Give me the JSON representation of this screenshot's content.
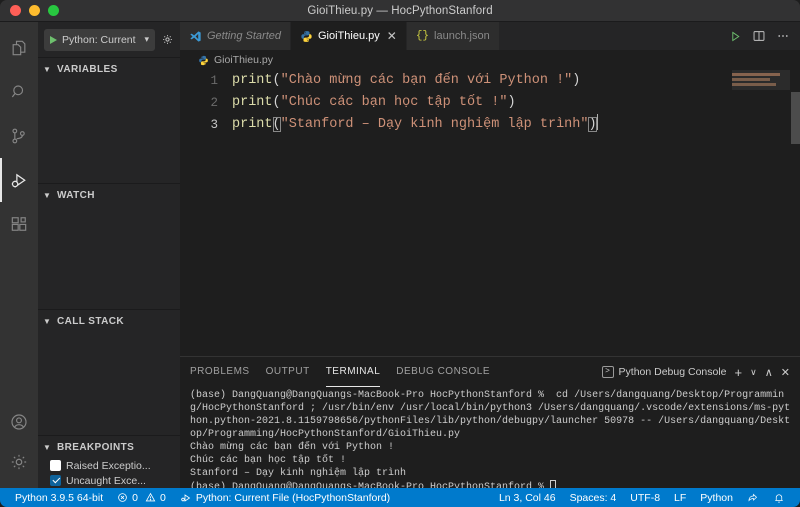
{
  "window": {
    "title": "GioiThieu.py — HocPythonStanford",
    "traffic_lights": [
      "close",
      "minimize",
      "zoom"
    ]
  },
  "activity_bar": {
    "top_items": [
      {
        "name": "explorer",
        "icon": "files-icon",
        "active": false
      },
      {
        "name": "search",
        "icon": "search-icon",
        "active": false
      },
      {
        "name": "source-control",
        "icon": "source-control-icon",
        "active": false
      },
      {
        "name": "run-and-debug",
        "icon": "run-debug-icon",
        "active": true
      },
      {
        "name": "extensions",
        "icon": "extensions-icon",
        "active": false
      }
    ],
    "bottom_items": [
      {
        "name": "accounts",
        "icon": "account-icon"
      },
      {
        "name": "settings",
        "icon": "gear-icon"
      }
    ]
  },
  "sidebar": {
    "launch_config": {
      "label": "Python: Current",
      "start_icon": "play-icon",
      "dropdown_icon": "chevron-down-icon",
      "settings_icon": "gear-icon"
    },
    "panes": [
      {
        "name": "variables",
        "title": "VARIABLES",
        "collapsed": false
      },
      {
        "name": "watch",
        "title": "WATCH",
        "collapsed": false
      },
      {
        "name": "call-stack",
        "title": "CALL STACK",
        "collapsed": false
      },
      {
        "name": "breakpoints",
        "title": "BREAKPOINTS",
        "collapsed": false
      }
    ],
    "breakpoints": [
      {
        "label": "Raised Exceptio...",
        "checked": false
      },
      {
        "label": "Uncaught Exce...",
        "checked": true
      }
    ]
  },
  "editor": {
    "tabs": [
      {
        "label": "Getting Started",
        "icon": "vscode-icon",
        "active": false,
        "italic": true,
        "closable": false
      },
      {
        "label": "GioiThieu.py",
        "icon": "python-icon",
        "active": true,
        "italic": false,
        "closable": true,
        "close_glyph": "✕"
      },
      {
        "label": "launch.json",
        "icon": "json-icon",
        "active": false,
        "italic": false,
        "closable": false
      }
    ],
    "actions": [
      {
        "name": "run-python-file",
        "icon": "play-icon"
      },
      {
        "name": "split-editor",
        "icon": "split-editor-icon"
      },
      {
        "name": "more-actions",
        "icon": "ellipsis-icon"
      }
    ],
    "breadcrumb": {
      "icon": "python-icon",
      "label": "GioiThieu.py"
    },
    "lines": [
      {
        "number": "1",
        "current": false,
        "tokens": [
          {
            "t": "fn",
            "v": "print"
          },
          {
            "t": "pn",
            "v": "("
          },
          {
            "t": "str",
            "v": "\"Chào mừng các bạn đến với Python !\""
          },
          {
            "t": "pn",
            "v": ")"
          }
        ]
      },
      {
        "number": "2",
        "current": false,
        "tokens": [
          {
            "t": "fn",
            "v": "print"
          },
          {
            "t": "pn",
            "v": "("
          },
          {
            "t": "str",
            "v": "\"Chúc các bạn học tập tốt !\""
          },
          {
            "t": "pn",
            "v": ")"
          }
        ]
      },
      {
        "number": "3",
        "current": true,
        "tokens": [
          {
            "t": "fn",
            "v": "print"
          },
          {
            "t": "brk",
            "v": "("
          },
          {
            "t": "str",
            "v": "\"Stanford – Dạy kinh nghiệm lập trình\""
          },
          {
            "t": "brk",
            "v": ")"
          }
        ]
      }
    ]
  },
  "panel": {
    "tabs": [
      {
        "label": "PROBLEMS",
        "active": false
      },
      {
        "label": "OUTPUT",
        "active": false
      },
      {
        "label": "TERMINAL",
        "active": true
      },
      {
        "label": "DEBUG CONSOLE",
        "active": false
      }
    ],
    "terminal_selector": {
      "label": "Python Debug Console",
      "icon": "terminal-icon",
      "glyph": ">"
    },
    "controls": [
      {
        "name": "new-terminal",
        "glyph": "+"
      },
      {
        "name": "terminal-dropdown",
        "glyph": "∨"
      },
      {
        "name": "maximize-panel",
        "glyph": "∧"
      },
      {
        "name": "close-panel",
        "glyph": "✕"
      }
    ],
    "terminal_lines": [
      "(base) DangQuang@DangQuangs-MacBook-Pro HocPythonStanford %  cd /Users/dangquang/Desktop/Programming/HocPythonStanford ; /usr/bin/env /usr/local/bin/python3 /Users/dangquang/.vscode/extensions/ms-python.python-2021.8.1159798656/pythonFiles/lib/python/debugpy/launcher 50978 -- /Users/dangquang/Desktop/Programming/HocPythonStanford/GioiThieu.py",
      "Chào mừng các bạn đến với Python !",
      "Chúc các bạn học tập tốt !",
      "Stanford – Dạy kinh nghiệm lập trình"
    ],
    "prompt_line": "(base) DangQuang@DangQuangs-MacBook-Pro HocPythonStanford % "
  },
  "status_bar": {
    "left": [
      {
        "name": "python-version",
        "label": "Python 3.9.5 64-bit",
        "icon": null
      },
      {
        "name": "problems",
        "label": "0",
        "label2": "0",
        "icon": "error-warning-icon"
      },
      {
        "name": "run-config",
        "label": "Python: Current File (HocPythonStanford)",
        "icon": "run-icon"
      }
    ],
    "right": [
      {
        "name": "cursor-position",
        "label": "Ln 3, Col 46"
      },
      {
        "name": "indentation",
        "label": "Spaces: 4"
      },
      {
        "name": "encoding",
        "label": "UTF-8"
      },
      {
        "name": "eol",
        "label": "LF"
      },
      {
        "name": "language-mode",
        "label": "Python"
      },
      {
        "name": "tweet-feedback",
        "label": "",
        "icon": "feedback-icon"
      },
      {
        "name": "notifications",
        "label": "",
        "icon": "bell-icon"
      }
    ]
  },
  "colors": {
    "accent": "#007acc",
    "titlebar": "#323233",
    "sidebar": "#252526",
    "editor_bg": "#1e1e1e",
    "activitybar": "#333333",
    "fn_token": "#dcdcaa",
    "string_token": "#ce9178",
    "punct_token": "#d4d4d4",
    "play_green": "#6ec06e"
  }
}
